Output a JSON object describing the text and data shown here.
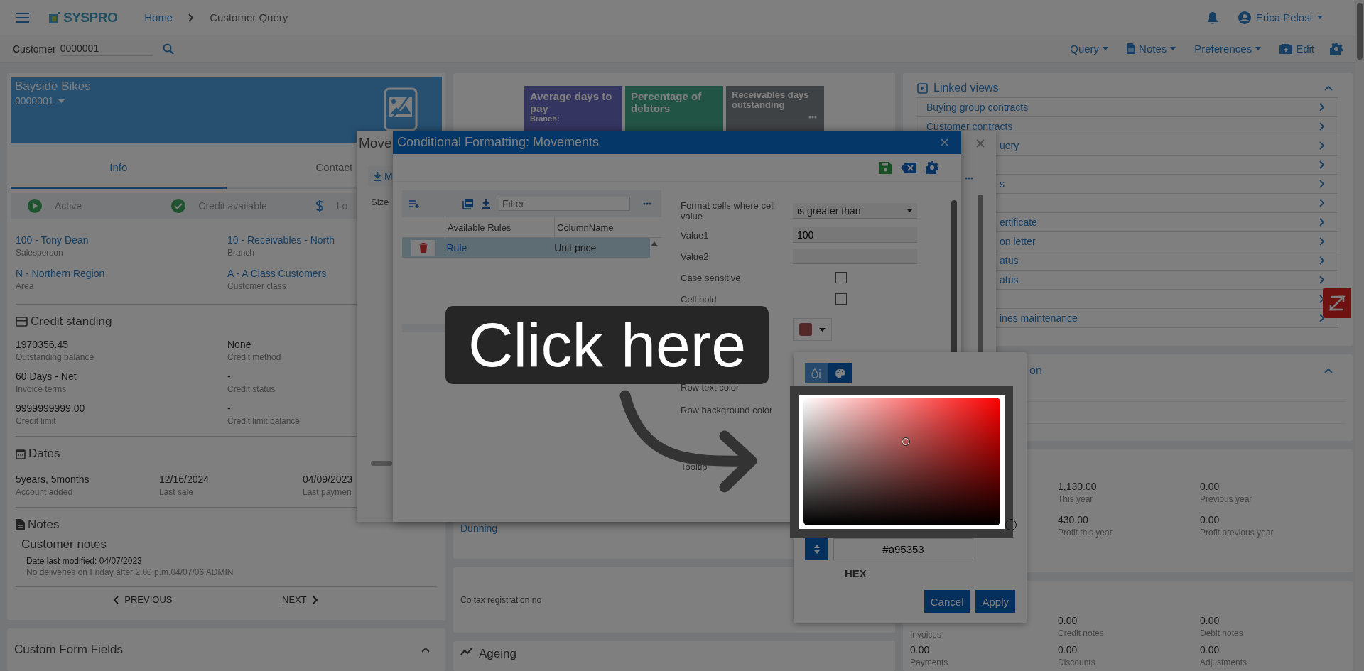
{
  "header": {
    "logo": "SYSPRO",
    "breadcrumb": [
      {
        "label": "Home",
        "kind": "link"
      },
      {
        "label": "Customer Query",
        "kind": "current"
      }
    ],
    "user": "Erica Pelosi"
  },
  "toolbar": {
    "customer_label": "Customer",
    "customer_value": "0000001",
    "actions": [
      {
        "label": "Query",
        "kind": "menu"
      },
      {
        "label": "Notes",
        "kind": "notes-menu"
      },
      {
        "label": "Preferences",
        "kind": "menu"
      },
      {
        "label": "Edit",
        "kind": "edit"
      }
    ]
  },
  "customer": {
    "name": "Bayside Bikes",
    "code": "0000001",
    "tabs": [
      {
        "label": "Info",
        "selected": true
      },
      {
        "label": "Contact",
        "selected": false
      }
    ],
    "statuses": [
      {
        "label": "Active",
        "kind": "active"
      },
      {
        "label": "Credit available",
        "kind": "credit"
      },
      {
        "label": "Lo",
        "kind": "currency"
      }
    ],
    "fields": [
      {
        "value": "100 - Tony Dean",
        "label": "Salesperson",
        "kind": "link"
      },
      {
        "value": "10 - Receivables - North",
        "label": "Branch",
        "kind": "link"
      },
      {
        "value": "N - Northern Region",
        "label": "Area",
        "kind": "link"
      },
      {
        "value": "A - A Class Customers",
        "label": "Customer class",
        "kind": "link"
      }
    ],
    "credit_standing": {
      "title": "Credit standing",
      "fields": [
        {
          "value": "1970356.45",
          "label": "Outstanding balance"
        },
        {
          "value": "None",
          "label": "Credit method"
        },
        {
          "value": "60 Days - Net",
          "label": "Invoice terms"
        },
        {
          "value": "-",
          "label": "Credit status"
        },
        {
          "value": "9999999999.00",
          "label": "Credit limit"
        },
        {
          "value": "-",
          "label": "Credit limit balance"
        }
      ]
    },
    "dates": {
      "title": "Dates",
      "fields": [
        {
          "value": "5years, 5months",
          "label": "Account added"
        },
        {
          "value": "12/16/2024",
          "label": "Last sale"
        },
        {
          "value": "04/09/2023",
          "label": "Last paymen"
        }
      ]
    },
    "notes": {
      "title": "Notes",
      "subtitle": "Customer notes",
      "modified": "Date last modified: 04/07/2023",
      "text": "No deliveries on Friday after 2.00 p.m.04/07/06 ADMIN"
    },
    "pager": {
      "previous": "PREVIOUS",
      "next": "NEXT"
    }
  },
  "custom_form_fields": {
    "title": "Custom Form Fields"
  },
  "kpis": [
    {
      "title": "Average days to pay",
      "subtitle": "Branch:"
    },
    {
      "title": "Percentage of debtors"
    },
    {
      "title": "Receivables days outstanding"
    }
  ],
  "dunning": "Dunning",
  "tax_registration": "Co tax registration no",
  "ageing": "Ageing",
  "linked_views": {
    "title": "Linked views",
    "items": [
      {
        "label": "Buying group contracts",
        "kind": "full"
      },
      {
        "label": "Customer contracts",
        "kind": "full"
      },
      {
        "label": "uery",
        "kind": "covered"
      },
      {
        "kind": "covered"
      },
      {
        "label": "s",
        "kind": "covered"
      },
      {
        "kind": "covered"
      },
      {
        "label": "ertificate",
        "kind": "covered"
      },
      {
        "label": "on letter",
        "kind": "covered"
      },
      {
        "label": "atus",
        "kind": "covered"
      },
      {
        "label": "atus",
        "kind": "covered"
      },
      {
        "kind": "covered"
      },
      {
        "label": "ines maintenance",
        "kind": "covered"
      }
    ]
  },
  "panel_2": {
    "title": "on"
  },
  "statistics": [
    {
      "cells": [
        {
          "value": "1,130.00",
          "label": "This year"
        },
        {
          "value": "0.00",
          "label": "Previous year"
        }
      ]
    },
    {
      "cells": [
        {
          "value": "430.00",
          "label": "Profit this year"
        },
        {
          "value": "0.00",
          "label": "Profit previous year"
        }
      ]
    }
  ],
  "balances": [
    {
      "cells": [
        {
          "label": "Invoices"
        },
        {
          "value": "0.00",
          "label": "Credit notes"
        },
        {
          "value": "0.00",
          "label": "Debit notes"
        }
      ]
    },
    {
      "cells": [
        {
          "value": "0.00",
          "label": "Payments"
        },
        {
          "value": "0.00",
          "label": "Discounts"
        },
        {
          "value": "0.00",
          "label": "Adjustments"
        }
      ]
    }
  ],
  "movements_dialog": {
    "title": "Move",
    "toolbar_label": "M",
    "column": "Size"
  },
  "conditional_formatting": {
    "title": "Conditional Formatting: Movements",
    "filter_placeholder": "Filter",
    "columns": [
      "Available Rules",
      "ColumnName"
    ],
    "rules": [
      {
        "name": "Rule",
        "column": "Unit price",
        "selected": true
      }
    ],
    "form": [
      {
        "kind": "select",
        "label": "Format cells where cell value",
        "value": "is greater than"
      },
      {
        "kind": "text",
        "label": "Value1",
        "value": "100"
      },
      {
        "kind": "text",
        "label": "Value2"
      },
      {
        "kind": "checkbox",
        "label": "Case sensitive",
        "checked": false
      },
      {
        "kind": "checkbox",
        "label": "Cell bold",
        "checked": false
      },
      {
        "kind": "color"
      },
      {
        "kind": "label",
        "label": "Row text color"
      },
      {
        "kind": "label",
        "label": "Row background color"
      },
      {
        "kind": "label",
        "label": "Tooltip"
      }
    ]
  },
  "color_picker": {
    "modes": [
      {
        "selected": false
      },
      {
        "selected": true
      }
    ],
    "hex": "#a95353",
    "format": "HEX",
    "buttons": [
      "Cancel",
      "Apply"
    ]
  },
  "callout": {
    "text": "Click here"
  }
}
